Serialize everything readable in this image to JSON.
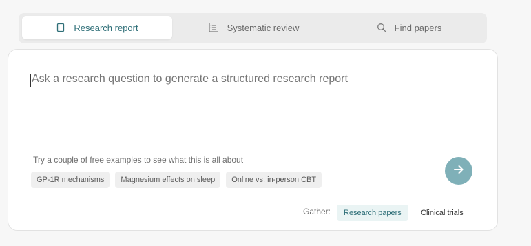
{
  "tabs": [
    {
      "label": "Research report",
      "icon": "book-icon",
      "active": true
    },
    {
      "label": "Systematic review",
      "icon": "chart-list-icon",
      "active": false
    },
    {
      "label": "Find papers",
      "icon": "search-icon",
      "active": false
    }
  ],
  "question": {
    "placeholder": "Ask a research question to generate a structured research report",
    "value": ""
  },
  "examples": {
    "hint": "Try a couple of free examples to see what this is all about",
    "chips": [
      "GP-1R mechanisms",
      "Magnesium effects on sleep",
      "Online vs. in-person CBT"
    ]
  },
  "submit": {
    "icon": "arrow-right-icon",
    "color": "#7fb0b8"
  },
  "gather": {
    "label": "Gather:",
    "options": [
      {
        "label": "Research papers",
        "selected": true
      },
      {
        "label": "Clinical trials",
        "selected": false
      }
    ]
  },
  "colors": {
    "accent": "#2f6f78",
    "submit": "#7fb0b8"
  }
}
